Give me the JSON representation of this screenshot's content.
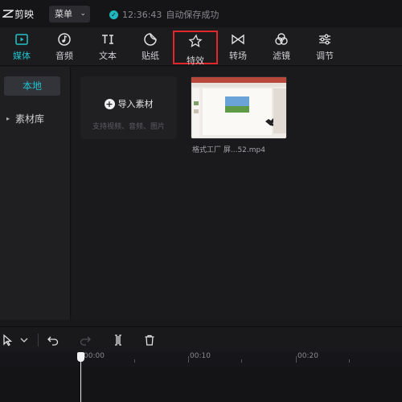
{
  "app": {
    "name": "剪映",
    "icon": "capcut-logo-icon"
  },
  "header": {
    "menu_label": "菜单",
    "menu_icon": "chevron-down-icon",
    "save_time": "12:36:43",
    "save_text": "自动保存成功",
    "save_icon": "check-circle-icon"
  },
  "toolbar": {
    "accent_color": "#20c1cb",
    "highlight_color": "#e3262b",
    "tabs": [
      {
        "label": "媒体",
        "icon": "media-icon",
        "active": true
      },
      {
        "label": "音频",
        "icon": "audio-icon"
      },
      {
        "label": "文本",
        "icon": "text-icon"
      },
      {
        "label": "贴纸",
        "icon": "sticker-icon"
      },
      {
        "label": "特效",
        "icon": "effects-icon",
        "highlighted": true
      },
      {
        "label": "转场",
        "icon": "transition-icon"
      },
      {
        "label": "滤镜",
        "icon": "filter-icon"
      },
      {
        "label": "调节",
        "icon": "adjust-icon"
      }
    ]
  },
  "sidebar": {
    "items": [
      {
        "label": "本地",
        "selected": true
      },
      {
        "label": "素材库",
        "icon": "triangle-right-icon"
      }
    ]
  },
  "media": {
    "import_label": "导入素材",
    "import_icon": "plus-icon",
    "import_hint": "支持视频、音频、图片",
    "files": [
      {
        "name": "格式工厂 屏...52.mp4"
      }
    ]
  },
  "timeline": {
    "tools": [
      "select-cursor-icon",
      "chevron-down-icon",
      "undo-icon",
      "redo-icon",
      "split-icon",
      "delete-icon"
    ],
    "ruler_labels": [
      "00:00",
      "00:10",
      "00:20"
    ]
  }
}
